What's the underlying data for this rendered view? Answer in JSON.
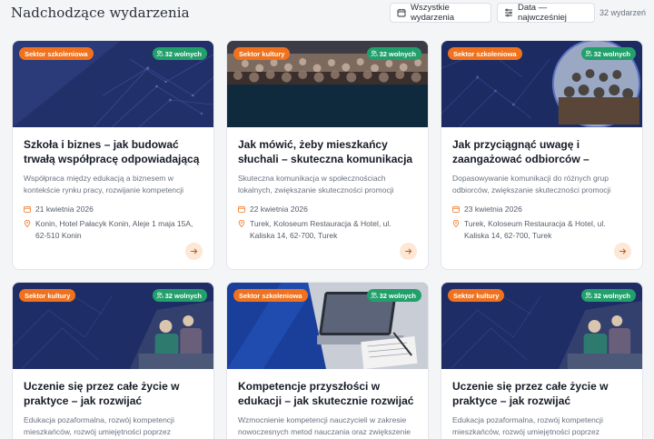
{
  "header": {
    "title": "Nadchodzące wydarzenia",
    "filter_label": "Wszystkie wydarzenia",
    "sort_label": "Data — najwcześniej",
    "count": "32 wydarzeń"
  },
  "colors": {
    "accent": "#f0721e",
    "seats": "#22a06b",
    "hero_dark": "#1a2a5e"
  },
  "cards": [
    {
      "sector": "Sektor szkoleniowa",
      "seats": "32 wolnych",
      "title": "Szkoła i biznes – jak budować trwałą współpracę odpowiadającą na…",
      "desc": "Współpraca między edukacją a biznesem w kontekście rynku pracy, rozwijanie kompetencji inicjowania i…",
      "date": "21 kwietnia 2026",
      "location": "Konin, Hotel Pałacyk Konin, Aleje 1 maja 15A, 62-510 Konin",
      "icon": "network-pattern"
    },
    {
      "sector": "Sektor kultury",
      "seats": "32 wolnych",
      "title": "Jak mówić, żeby mieszkańcy słuchali – skuteczna komunikacja lokalna",
      "desc": "Skuteczna komunikacja w społecznościach lokalnych, zwiększanie skuteczności promocji działań…",
      "date": "22 kwietnia 2026",
      "location": "Turek, Koloseum Restauracja & Hotel, ul. Kaliska 14, 62-700, Turek",
      "icon": "audience-photo"
    },
    {
      "sector": "Sektor szkoleniowa",
      "seats": "32 wolnych",
      "title": "Jak przyciągnąć uwagę i zaangażować odbiorców – skuteczna komunika…",
      "desc": "Dopasowywanie komunikacji do różnych grup odbiorców, zwiększanie skuteczności promocji działa…",
      "date": "23 kwietnia 2026",
      "location": "Turek, Koloseum Restauracja & Hotel, ul. Kaliska 14, 62-700, Turek",
      "icon": "audience-circle"
    },
    {
      "sector": "Sektor kultury",
      "seats": "32 wolnych",
      "title": "Uczenie się przez całe życie w praktyce – jak rozwijać kompetencje…",
      "desc": "Edukacja pozaformalna, rozwój kompetencji mieszkańców, rozwój umiejętności poprzez hobby,…",
      "date": "",
      "location": "",
      "icon": "people-photo"
    },
    {
      "sector": "Sektor szkoleniowa",
      "seats": "32 wolnych",
      "title": "Kompetencje przyszłości w edukacji – jak skutecznie rozwijać je od…",
      "desc": "Wzmocnienie kompetencji nauczycieli w zakresie nowoczesnych metod nauczania oraz zwiększenie ro…",
      "date": "",
      "location": "",
      "icon": "laptop-photo"
    },
    {
      "sector": "Sektor kultury",
      "seats": "32 wolnych",
      "title": "Uczenie się przez całe życie w praktyce – jak rozwijać kompetencje…",
      "desc": "Edukacja pozaformalna, rozwój kompetencji mieszkańców, rozwój umiejętności poprzez hobby,…",
      "date": "",
      "location": "",
      "icon": "people-photo"
    }
  ]
}
